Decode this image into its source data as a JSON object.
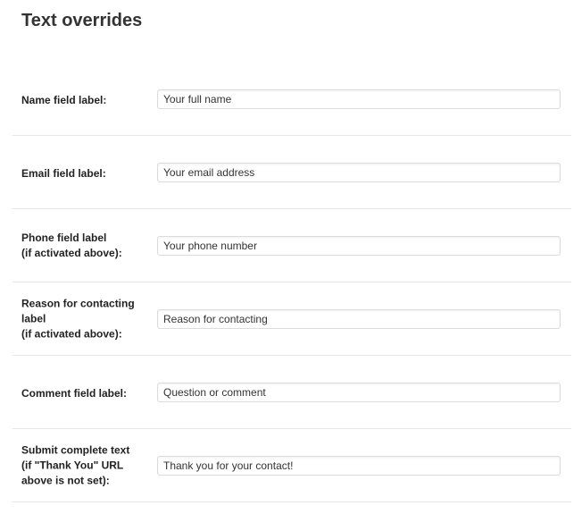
{
  "page": {
    "title": "Text overrides"
  },
  "rows": [
    {
      "label_lines": [
        "Name field label:"
      ],
      "value": "Your full name"
    },
    {
      "label_lines": [
        "Email field label:"
      ],
      "value": "Your email address"
    },
    {
      "label_lines": [
        "Phone field label",
        "(if activated above):"
      ],
      "value": "Your phone number"
    },
    {
      "label_lines": [
        "Reason for contacting",
        "label",
        "(if activated above):"
      ],
      "value": "Reason for contacting"
    },
    {
      "label_lines": [
        "Comment field label:"
      ],
      "value": "Question or comment"
    },
    {
      "label_lines": [
        "Submit complete text",
        "(if \"Thank You\" URL",
        "above is not set):"
      ],
      "value": "Thank you for your contact!"
    }
  ]
}
